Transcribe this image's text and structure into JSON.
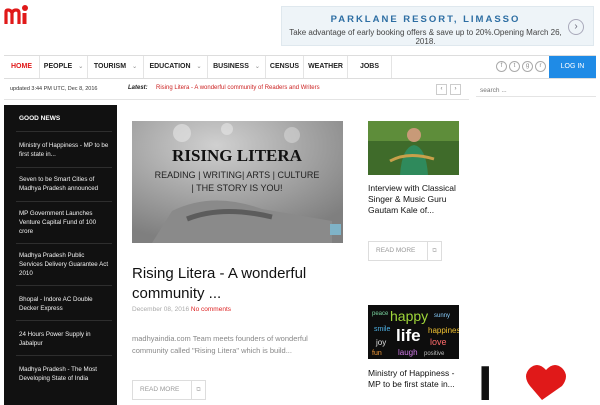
{
  "site": {
    "logo_text": "mi"
  },
  "ad": {
    "headline": "PARKLANE RESORT, LIMASSO",
    "text": "Take advantage of early booking offers & save up to 20%.Opening March 26, 2018.",
    "next_icon": "chevron-right-icon"
  },
  "nav": {
    "items": [
      {
        "label": "HOME",
        "active": true
      },
      {
        "label": "PEOPLE",
        "dropdown": true
      },
      {
        "label": "TOURISM",
        "dropdown": true
      },
      {
        "label": "EDUCATION",
        "dropdown": true
      },
      {
        "label": "BUSINESS",
        "dropdown": true
      },
      {
        "label": "CENSUS"
      },
      {
        "label": "WEATHER"
      },
      {
        "label": "JOBS"
      }
    ],
    "social": [
      "facebook-icon",
      "twitter-icon",
      "google-plus-icon",
      "rss-icon"
    ],
    "login_label": "LOG IN"
  },
  "subbar": {
    "updated": "updated 3:44 PM UTC, Dec 8, 2016",
    "latest_label": "Latest:",
    "latest_text": "Rising Litera - A wonderful community of Readers and Writers"
  },
  "search": {
    "placeholder": "search ..."
  },
  "good_news": {
    "heading": "GOOD NEWS",
    "items": [
      "Ministry of Happiness - MP to be first state in...",
      "Seven to be Smart Cities of Madhya Pradesh announced",
      "MP Government Launches Venture Capital Fund of 100 crore",
      "Madhya Pradesh Public Services Delivery Guarantee Act 2010",
      "Bhopal - Indore AC Double Decker Express",
      "24 Hours Power Supply in Jabalpur",
      "Madhya Pradesh - The Most Developing State of India"
    ]
  },
  "featured": {
    "image_text": {
      "title": "RISING LITERA",
      "line1": "READING | WRITING| ARTS | CULTURE",
      "line2": "| THE STORY IS YOU!"
    },
    "title": "Rising Litera - A wonderful community ...",
    "date": "December 08, 2016",
    "comments": "No comments",
    "excerpt": "madhyaindia.com Team meets founders of wonderful community called \"Rising Litera\" which is build...",
    "read_more": "READ MORE"
  },
  "cards": [
    {
      "title": "Interview with Classical Singer & Music Guru Gautam Kale of...",
      "read_more": "READ MORE"
    },
    {
      "title": "Ministry of Happiness - MP to be first state in...",
      "image_words": [
        "happy",
        "life",
        "happiness",
        "smile",
        "love",
        "joy",
        "laugh",
        "fun",
        "sunny",
        "positive",
        "peace"
      ]
    }
  ],
  "ilove": {
    "text": "I"
  },
  "colors": {
    "accent": "#e01919",
    "login": "#1f8be6",
    "sidebar": "#111111"
  }
}
